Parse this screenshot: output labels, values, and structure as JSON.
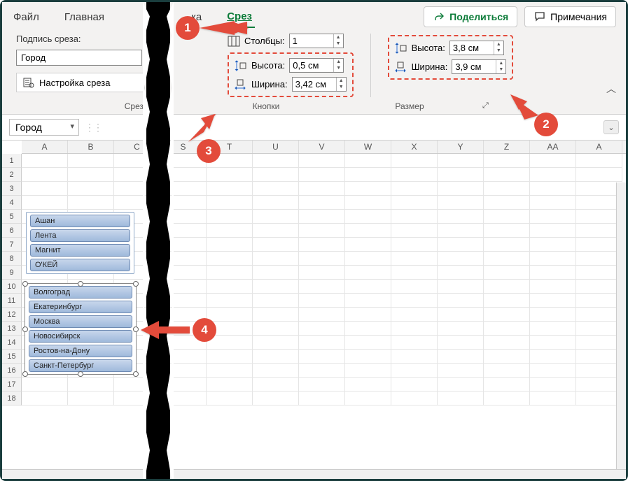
{
  "tabs": {
    "file": "Файл",
    "home": "Главная",
    "partial": "ка",
    "slicer": "Срез"
  },
  "actions": {
    "share": "Поделиться",
    "comments": "Примечания"
  },
  "caption": {
    "label": "Подпись среза:",
    "value": "Город",
    "settings": "Настройка среза"
  },
  "buttons_group": {
    "columns_label": "Столбцы:",
    "columns_value": "1",
    "height_label": "Высота:",
    "height_value": "0,5 см",
    "width_label": "Ширина:",
    "width_value": "3,42 см"
  },
  "size_group": {
    "height_label": "Высота:",
    "height_value": "3,8 см",
    "width_label": "Ширина:",
    "width_value": "3,9 см"
  },
  "group_names": {
    "slicer": "Срез",
    "buttons": "Кнопки",
    "size": "Размер"
  },
  "namebox": "Город",
  "columns": [
    "A",
    "B",
    "C",
    "S",
    "T",
    "U",
    "V",
    "W",
    "X",
    "Y",
    "Z",
    "AA",
    "A"
  ],
  "rows": [
    "1",
    "2",
    "3",
    "4",
    "5",
    "6",
    "7",
    "8",
    "9",
    "10",
    "11",
    "12",
    "13",
    "14",
    "15",
    "16",
    "17",
    "18"
  ],
  "slicer1": {
    "items": [
      "Ашан",
      "Лента",
      "Магнит",
      "О'КЕЙ"
    ]
  },
  "slicer2": {
    "items": [
      "Волгоград",
      "Екатеринбург",
      "Москва",
      "Новосибирск",
      "Ростов-на-Дону",
      "Санкт-Петербург"
    ]
  },
  "callouts": {
    "n1": "1",
    "n2": "2",
    "n3": "3",
    "n4": "4"
  }
}
